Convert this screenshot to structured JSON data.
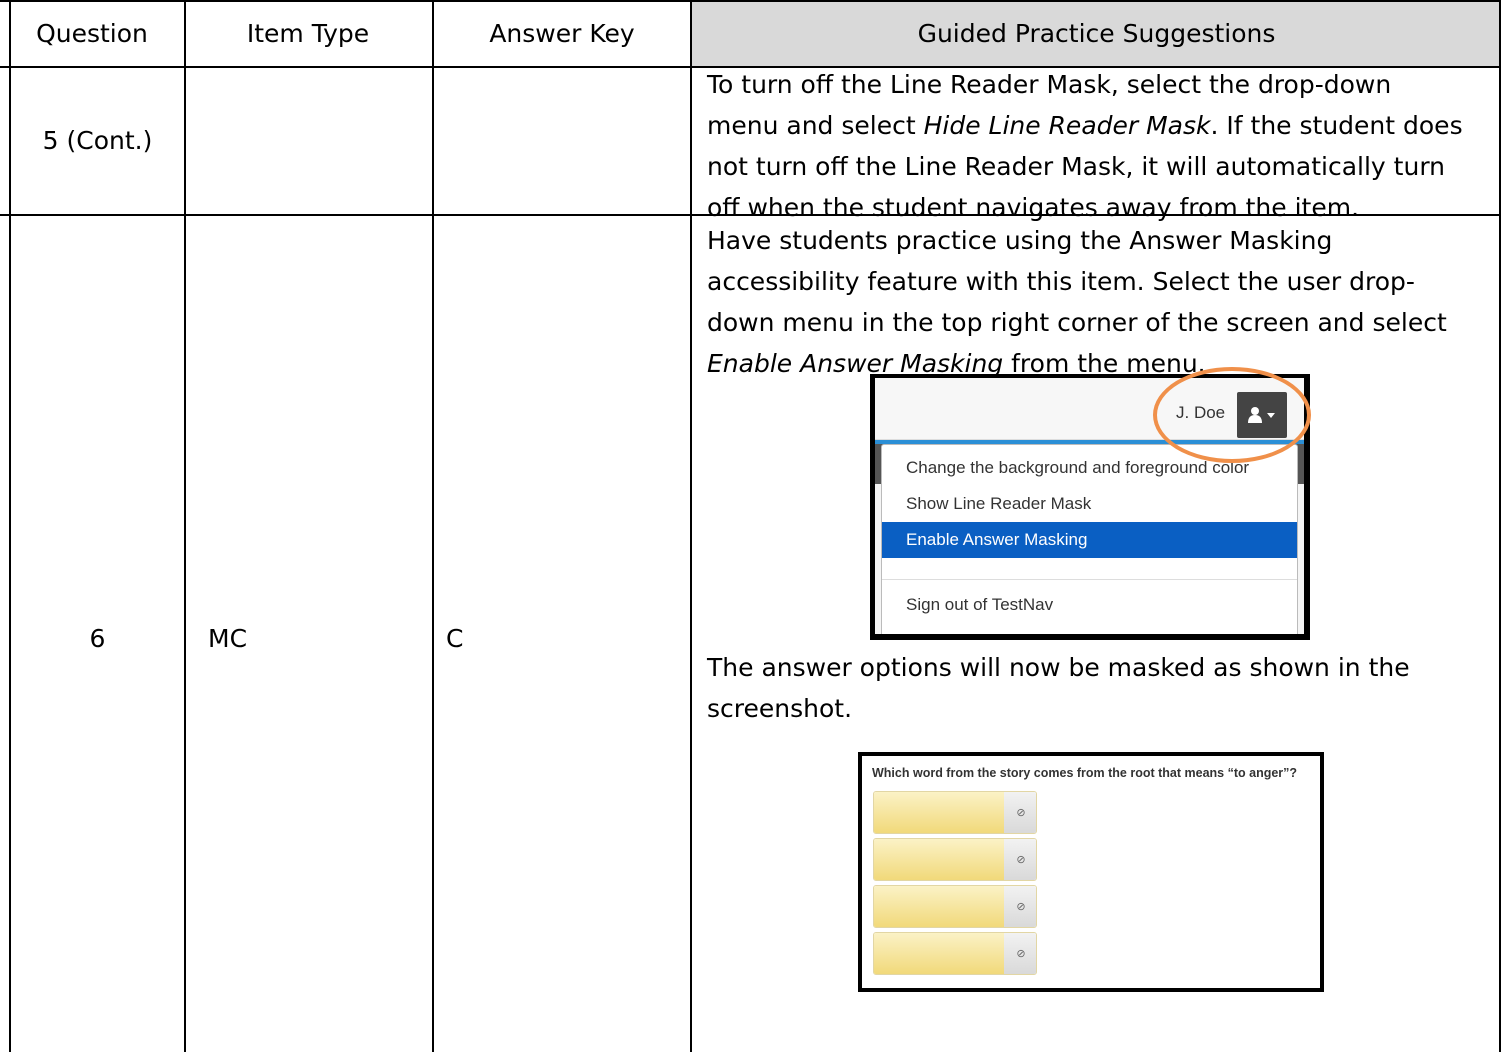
{
  "table": {
    "headers": {
      "question": "Question",
      "item_type": "Item Type",
      "answer_key": "Answer Key",
      "suggestions": "Guided Practice Suggestions"
    },
    "rows": [
      {
        "question": "5 (Cont.)",
        "item_type": "",
        "answer_key": "",
        "suggestion_lines": [
          "To turn off the Line Reader Mask, select the drop-down",
          "menu and select ",
          "Hide Line Reader Mask",
          ".  If the student does",
          "not turn off the Line Reader Mask, it will automatically turn",
          "off when the student navigates away from the item."
        ]
      },
      {
        "question": "6",
        "item_type": "MC",
        "answer_key": "C",
        "suggestion_lines": [
          "Have students practice using the Answer Masking",
          "accessibility feature with this item. Select the user drop-",
          "down menu in the top right corner of the screen and select",
          "Enable Answer Masking",
          " from the menu."
        ],
        "after_text": [
          "The answer options will now be masked as shown in the",
          "screenshot."
        ]
      }
    ]
  },
  "dropdown_screenshot": {
    "user_name": "J. Doe",
    "user_icon": "user-icon",
    "caret_icon": "caret-down-icon",
    "menu_items": [
      "Change the background and foreground color",
      "Show Line Reader Mask",
      "Enable Answer Masking",
      "Sign out of TestNav"
    ],
    "selected_item": "Enable Answer Masking",
    "highlight_color": "#0a5fc3",
    "callout_color": "#f0904a"
  },
  "masked_screenshot": {
    "question_text": "Which word from the story comes from the root that means “to anger”?",
    "option_count": 4,
    "mask_icon": "eye-slash-icon",
    "mask_color": "#f1d97a"
  }
}
